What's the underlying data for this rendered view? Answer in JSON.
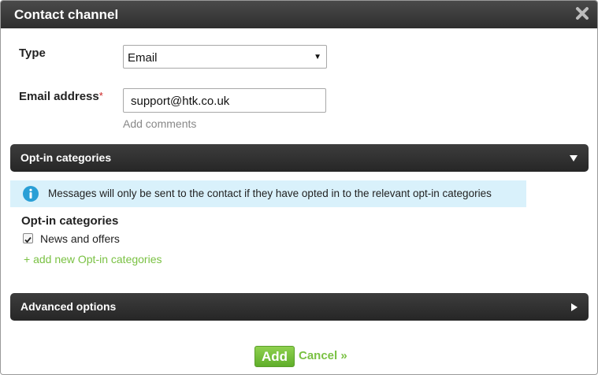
{
  "dialog": {
    "title": "Contact channel",
    "close_icon": "close-icon"
  },
  "form": {
    "type_label": "Type",
    "type_value": "Email",
    "email_label": "Email address",
    "required_marker": "*",
    "email_value": "support@htk.co.uk",
    "add_comments": "Add comments"
  },
  "optin_section": {
    "title": "Opt-in categories",
    "expanded": true,
    "info_message": "Messages will only be sent to the contact if they have opted in to the relevant opt-in categories",
    "categories_heading": "Opt-in categories",
    "categories": [
      {
        "label": "News and offers",
        "checked": true
      }
    ],
    "add_link": "+ add new Opt-in categories"
  },
  "advanced_section": {
    "title": "Advanced options",
    "expanded": false
  },
  "footer": {
    "add_label": "Add",
    "cancel_label": "Cancel »"
  },
  "colors": {
    "titlebar": "#333333",
    "accent_green": "#7ac143",
    "info_bg": "#d9f1fb",
    "info_icon": "#2a9fd6",
    "required": "#cc2222"
  }
}
